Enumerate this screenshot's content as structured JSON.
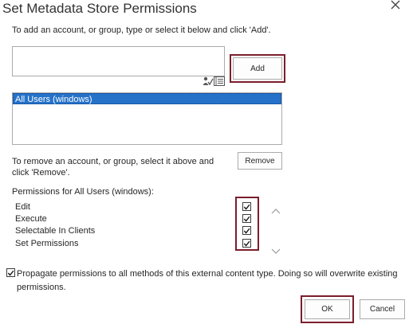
{
  "dialog": {
    "title": "Set Metadata Store Permissions",
    "intro_text": "To add an account, or group, type or select it below and click 'Add'.",
    "people_input": {
      "value": "",
      "placeholder": ""
    },
    "add_label": "Add",
    "accounts": [
      "All Users (windows)"
    ],
    "selected_account": "All Users (windows)",
    "remove_text": "To remove an account, or group, select it above and click 'Remove'.",
    "remove_label": "Remove",
    "permissions_header": "Permissions for All Users (windows):",
    "permissions": [
      {
        "label": "Edit",
        "checked": true
      },
      {
        "label": "Execute",
        "checked": true
      },
      {
        "label": "Selectable In Clients",
        "checked": true
      },
      {
        "label": "Set Permissions",
        "checked": true
      }
    ],
    "propagate": {
      "checked": true,
      "label": "Propagate permissions to all methods of this external content type. Doing so will overwrite existing permissions."
    },
    "ok_label": "OK",
    "cancel_label": "Cancel"
  },
  "icons": {
    "close": "close-icon",
    "check_names": "check-names-icon",
    "browse": "address-book-icon",
    "scroll_up": "chevron-up-icon",
    "scroll_down": "chevron-down-icon"
  },
  "colors": {
    "selection": "#2672c9",
    "highlight_border": "#7b1e2c"
  }
}
